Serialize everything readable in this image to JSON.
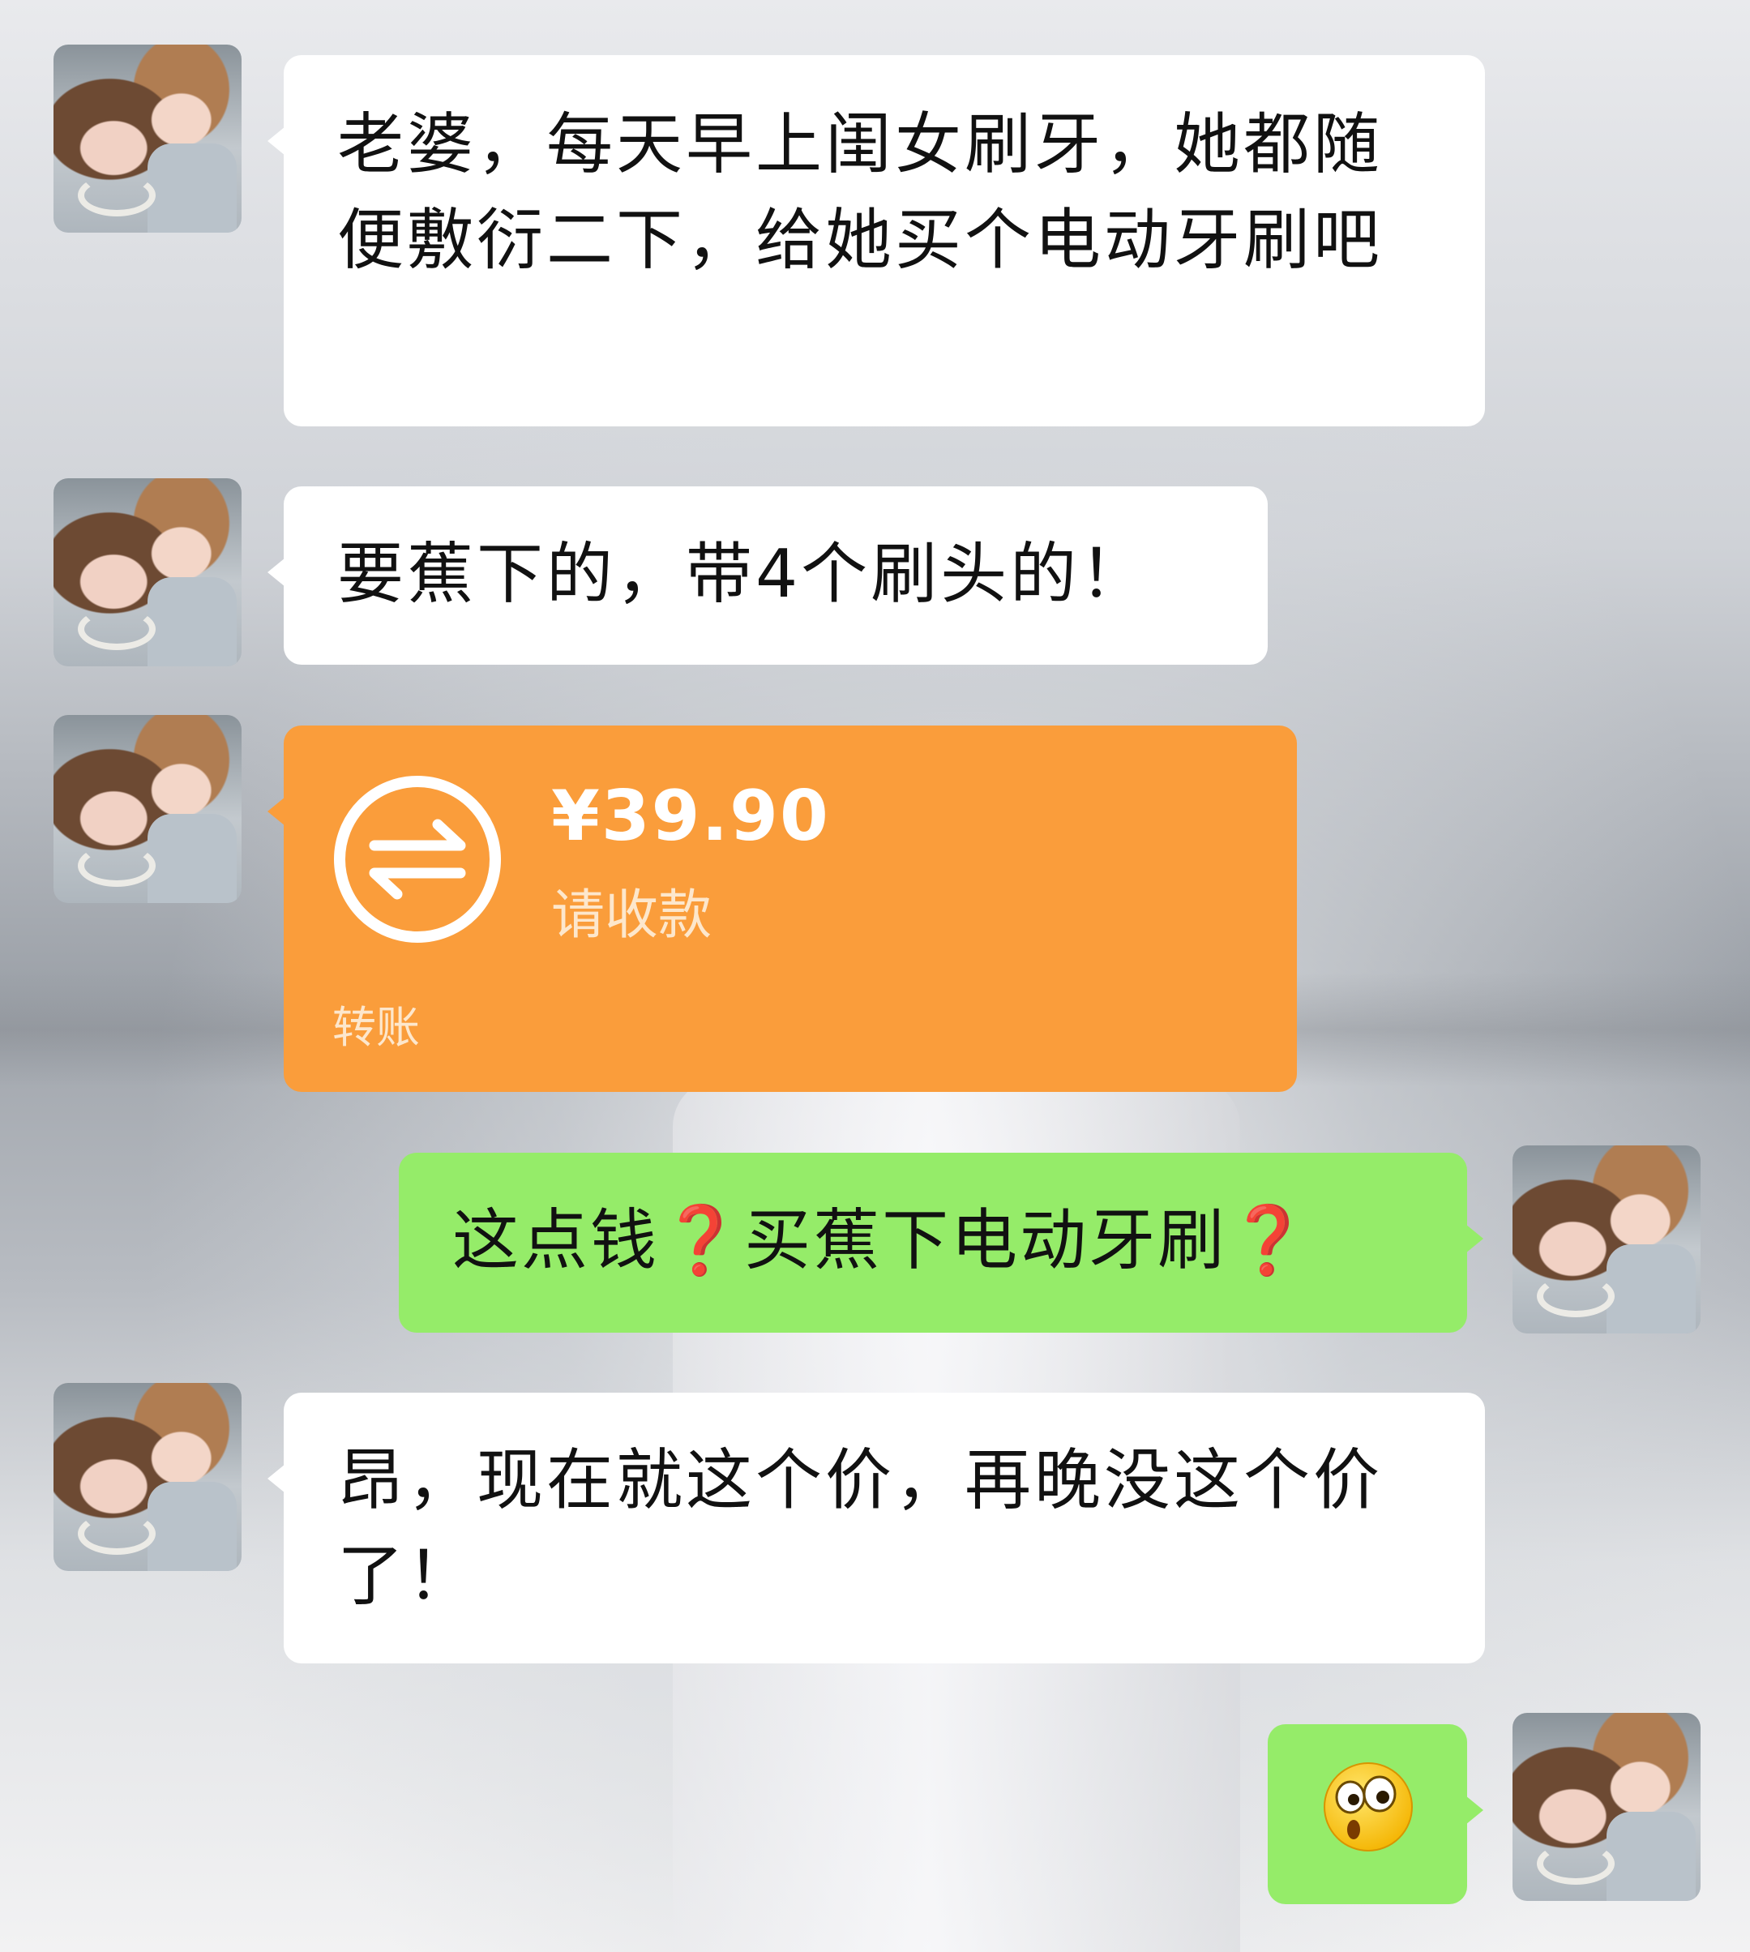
{
  "chat": {
    "messages": [
      {
        "id": "m1",
        "sender": "contact",
        "type": "text",
        "text": "老婆，每天早上闺女刷牙，她都随便敷衍二下，给她买个电动牙刷吧"
      },
      {
        "id": "m2",
        "sender": "contact",
        "type": "text",
        "text": "要蕉下的，带4个刷头的！"
      },
      {
        "id": "m3",
        "sender": "contact",
        "type": "transfer",
        "amount": "¥39.90",
        "status": "请收款",
        "label": "转账"
      },
      {
        "id": "m4",
        "sender": "me",
        "type": "text",
        "parts": [
          "这点钱",
          "❓",
          "买蕉下电动牙刷",
          "❓"
        ]
      },
      {
        "id": "m5",
        "sender": "contact",
        "type": "text",
        "text": "昂，现在就这个价，再晚没这个价了！"
      },
      {
        "id": "m6",
        "sender": "me",
        "type": "emoji",
        "emoji": "surprised-face-emoji"
      }
    ]
  },
  "colors": {
    "incoming_bubble": "#ffffff",
    "outgoing_bubble": "#95ec69",
    "transfer_bubble": "#fa9d3b",
    "question_mark": "#e0191f"
  },
  "icons": {
    "transfer": "transfer-arrows-icon",
    "avatar": "couple-photo-avatar"
  }
}
